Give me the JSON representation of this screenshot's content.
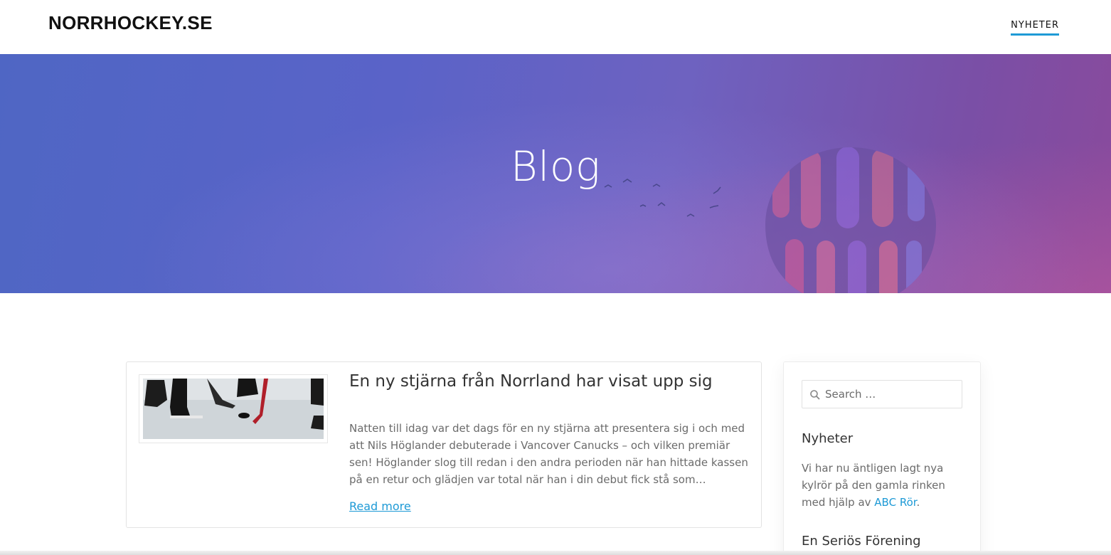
{
  "header": {
    "site_title": "NORRHOCKEY.SE",
    "nav": [
      {
        "label": "NYHETER",
        "active": true
      }
    ]
  },
  "hero": {
    "title": "Blog"
  },
  "posts": [
    {
      "title": "En ny stjärna från Norrland har visat upp sig",
      "excerpt": "Natten till idag var det dags för en ny stjärna att presentera sig i och med att Nils Höglander debuterade i Vancover Canucks – och vilken premiär sen! Höglander slog till redan i den andra perioden när han hittade kassen på en retur och glädjen var total när han i din debut fick stå som…",
      "read_more": "Read more"
    }
  ],
  "sidebar": {
    "search": {
      "placeholder": "Search …"
    },
    "widgets": [
      {
        "title": "Nyheter",
        "text_before_link": "Vi har nu äntligen lagt nya kylrör på den gamla rinken med hjälp av ",
        "link": "ABC Rör",
        "text_after_link": "."
      },
      {
        "title": "En Seriös Förening"
      }
    ]
  },
  "colors": {
    "accent": "#1e9ad6",
    "hero_gradient_start": "#4f66c4",
    "hero_gradient_end": "#8a4a9c"
  },
  "icons": {
    "search": "search-icon",
    "balloon": "hot-air-balloon-icon",
    "birds": "birds-icon"
  }
}
